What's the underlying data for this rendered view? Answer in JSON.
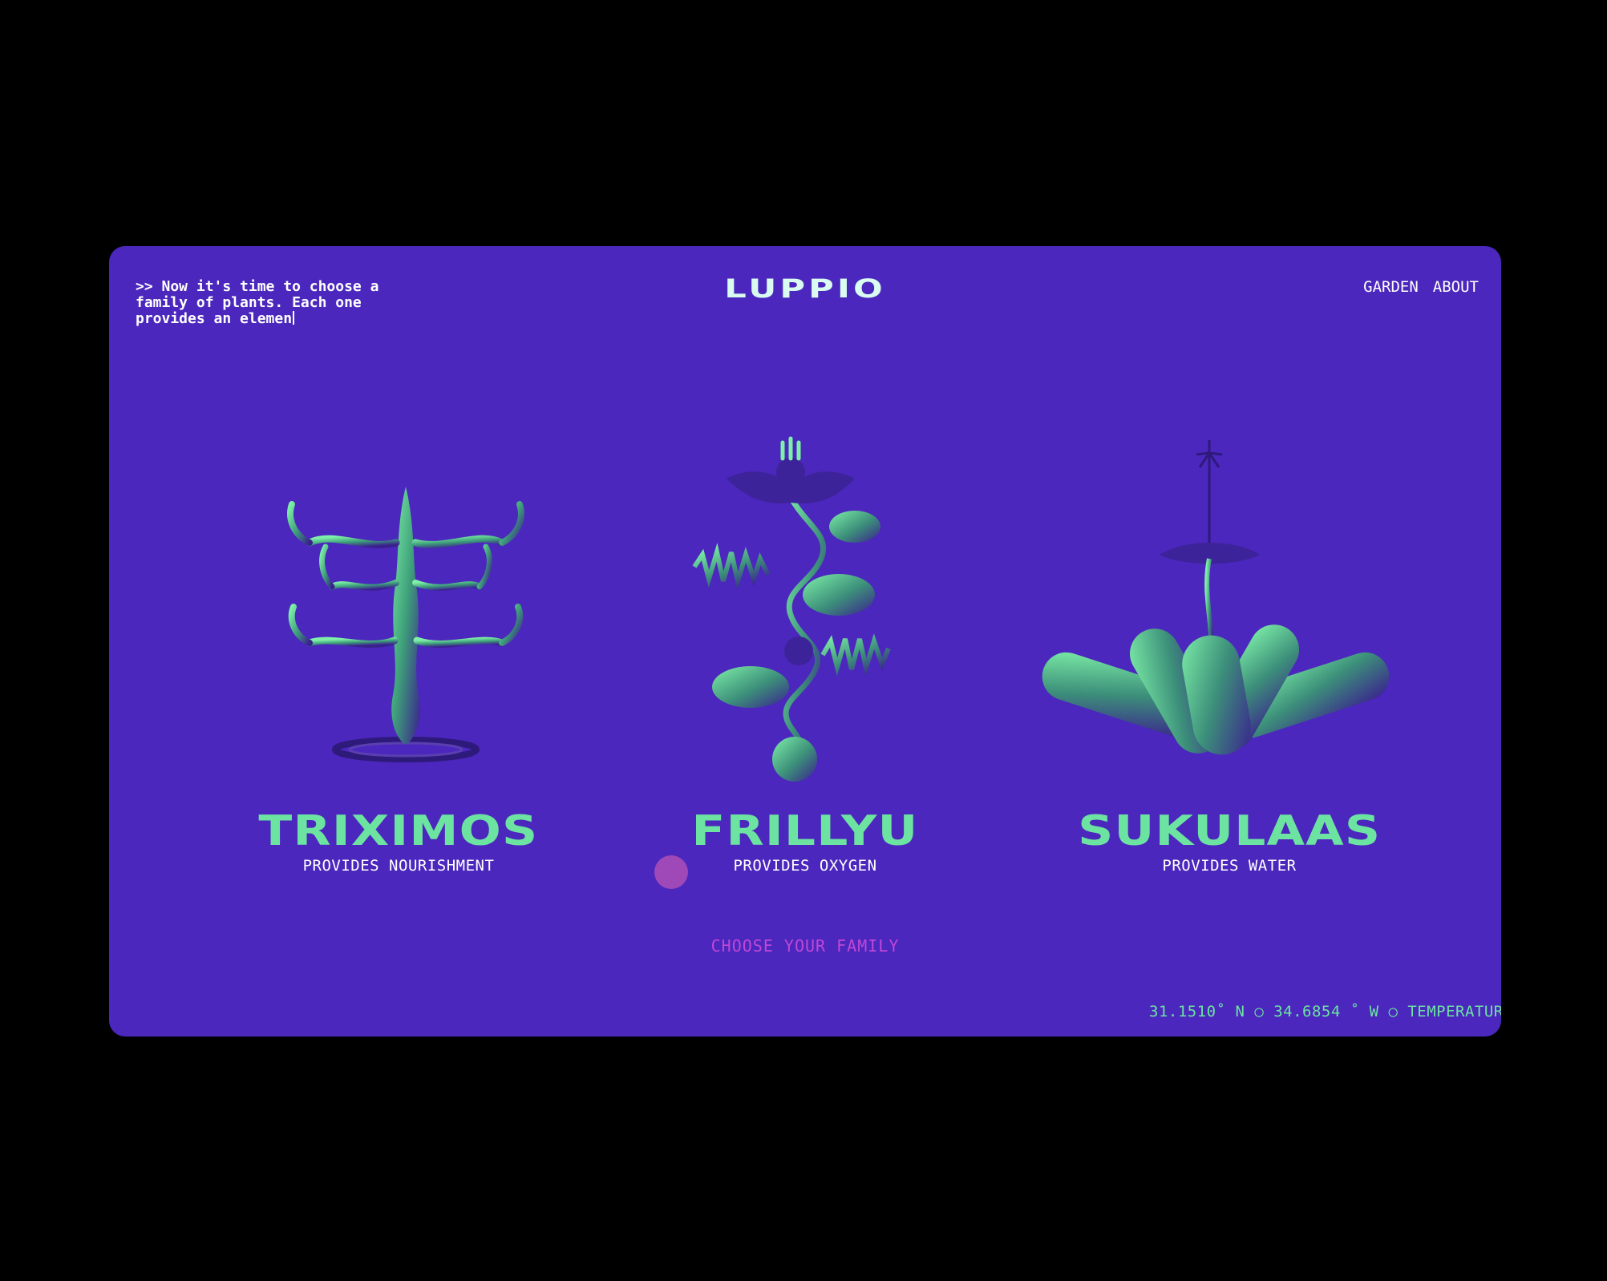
{
  "intro_text": ">> Now it's time to choose a\nfamily of plants. Each one\nprovides an elemen",
  "brand": "LUPPIO",
  "nav": {
    "garden": "GARDEN",
    "about": "ABOUT"
  },
  "families": [
    {
      "name": "TRIXIMOS",
      "desc": "PROVIDES NOURISHMENT"
    },
    {
      "name": "FRILLYU",
      "desc": "PROVIDES OXYGEN"
    },
    {
      "name": "SUKULAAS",
      "desc": "PROVIDES WATER"
    }
  ],
  "cta": "CHOOSE YOUR FAMILY",
  "ticker": "31.1510˚ N ○ 34.6854 ˚ W ○ TEMPERATUR",
  "colors": {
    "background": "#000000",
    "panel": "#4b27bd",
    "accent_green": "#6ce3a1",
    "accent_magenta": "#c147d6",
    "text": "#ffffff"
  }
}
